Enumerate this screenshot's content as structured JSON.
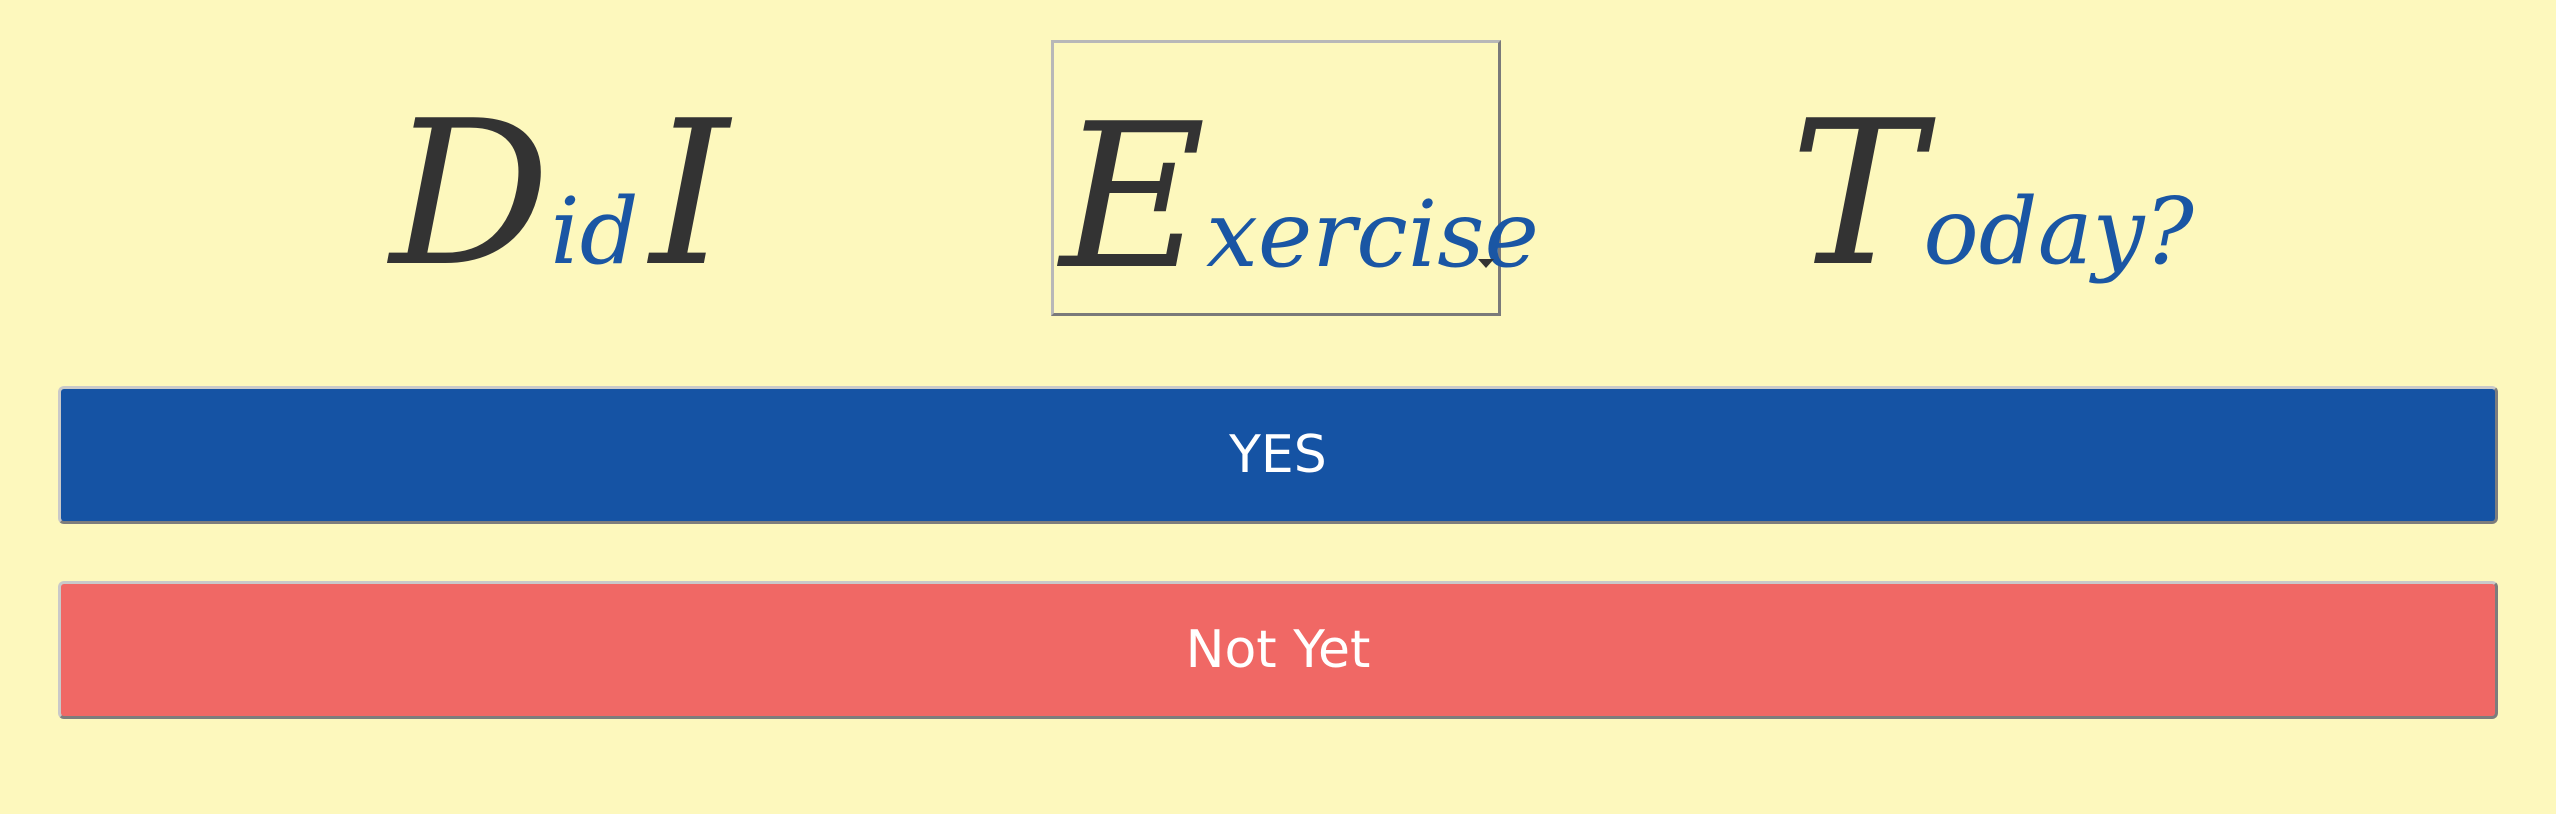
{
  "page": {
    "background": "#fdf8bd"
  },
  "headline": {
    "word1": {
      "cap": "D",
      "rest": "id"
    },
    "word2": {
      "cap": "I",
      "rest": ""
    },
    "activity_select": {
      "selected": {
        "cap": "E",
        "rest": "xercise"
      },
      "icon": "chevron-down-icon"
    },
    "word4": {
      "cap": "T",
      "rest": "oday?"
    },
    "cap_color": "#333333",
    "rest_color": "#1a56a4"
  },
  "buttons": {
    "yes_label": "YES",
    "yes_color": "#1553a4",
    "no_label": "Not Yet",
    "no_color": "#f06865"
  }
}
